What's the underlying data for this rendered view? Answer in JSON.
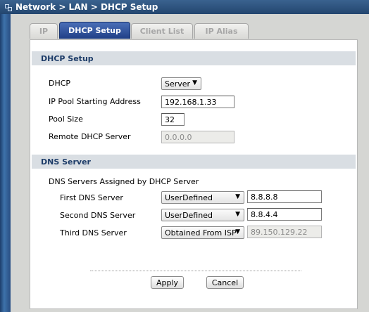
{
  "window": {
    "title": "Network > LAN > DHCP Setup"
  },
  "tabs": [
    {
      "label": "IP"
    },
    {
      "label": "DHCP Setup"
    },
    {
      "label": "Client List"
    },
    {
      "label": "IP Alias"
    }
  ],
  "dhcp_setup": {
    "heading": "DHCP Setup",
    "dhcp_label": "DHCP",
    "dhcp_value": "Server",
    "pool_start_label": "IP Pool Starting Address",
    "pool_start_value": "192.168.1.33",
    "pool_size_label": "Pool Size",
    "pool_size_value": "32",
    "remote_label": "Remote DHCP Server",
    "remote_value": "0.0.0.0"
  },
  "dns_server": {
    "heading": "DNS Server",
    "assigned_label": "DNS Servers Assigned by DHCP Server",
    "rows": [
      {
        "label": "First DNS Server",
        "mode": "UserDefined",
        "ip": "8.8.8.8"
      },
      {
        "label": "Second DNS Server",
        "mode": "UserDefined",
        "ip": "8.8.4.4"
      },
      {
        "label": "Third DNS Server",
        "mode": "Obtained From ISP",
        "ip": "89.150.129.22"
      }
    ]
  },
  "buttons": {
    "apply": "Apply",
    "cancel": "Cancel"
  }
}
